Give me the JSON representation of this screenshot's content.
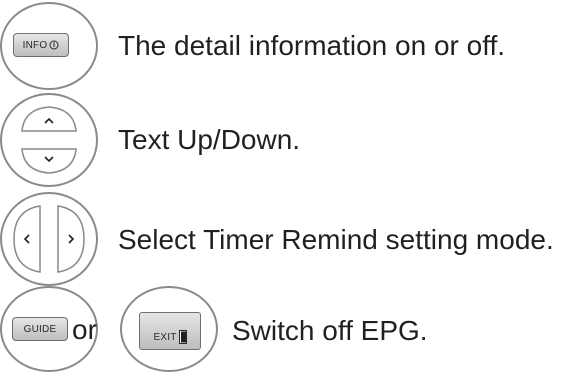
{
  "rows": [
    {
      "key_label": "INFO",
      "key_icon": "info-circle-icon",
      "description": "The detail information on or off."
    },
    {
      "key_icon": "up-down-rocker-icon",
      "description": "Text Up/Down."
    },
    {
      "key_icon": "left-right-rocker-icon",
      "description": "Select Timer Remind setting mode."
    },
    {
      "key_label": "GUIDE",
      "or_label": "or",
      "exit_label": "EXIT",
      "description": "Switch off EPG."
    }
  ],
  "colors": {
    "text": "#231f20",
    "outline": "#8a8a8a",
    "key_fill": "#d4d4d4"
  }
}
